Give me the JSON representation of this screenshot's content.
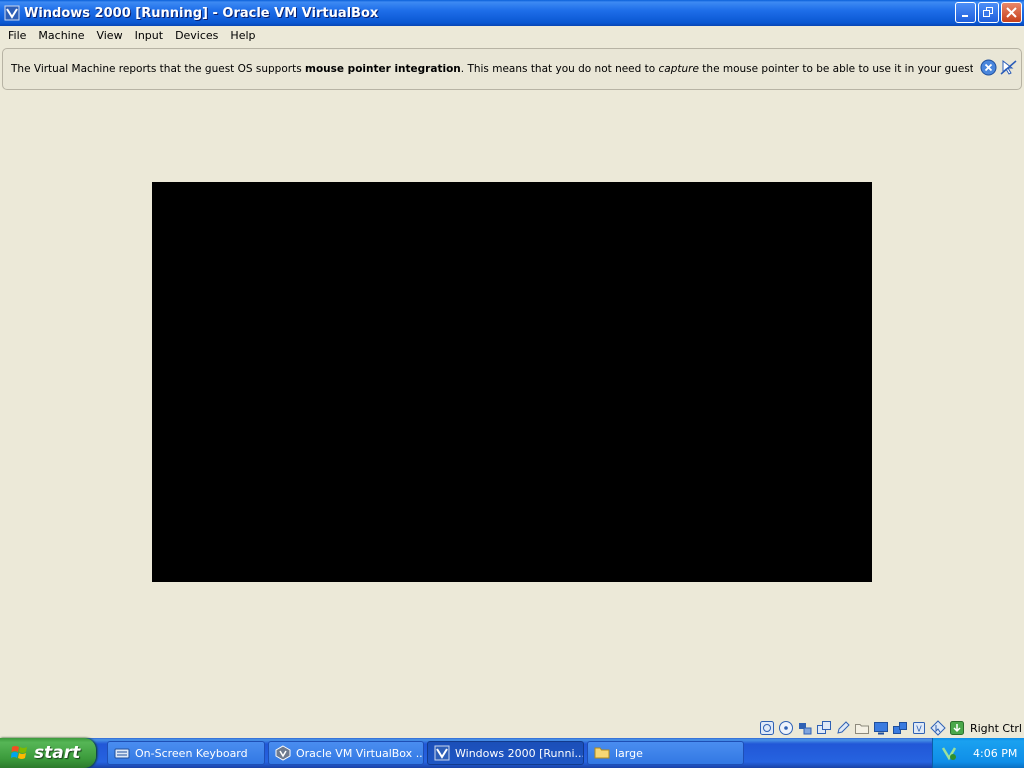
{
  "window": {
    "title": "Windows 2000 [Running] - Oracle VM VirtualBox"
  },
  "menubar": {
    "items": [
      "File",
      "Machine",
      "View",
      "Input",
      "Devices",
      "Help"
    ]
  },
  "banner": {
    "text_1": "The Virtual Machine reports that the guest OS supports ",
    "bold": "mouse pointer integration",
    "text_2": ". This means that you do not need to ",
    "italic": "capture",
    "text_3": " the mouse pointer to be able to use it in your guest OS -- all mouse"
  },
  "statusbar": {
    "host_key": "Right Ctrl",
    "icons": [
      "hard-disk-icon",
      "optical-drive-icon",
      "usb-icon",
      "shared-folders-icon",
      "pencil-icon",
      "folder-icon",
      "display-icon",
      "network-icon",
      "cpu-icon",
      "mouse-integration-icon",
      "host-key-icon"
    ]
  },
  "taskbar": {
    "start_label": "start",
    "tasks": [
      {
        "label": "On-Screen Keyboard",
        "icon": "keyboard-icon",
        "active": false
      },
      {
        "label": "Oracle VM VirtualBox ...",
        "icon": "virtualbox-icon",
        "active": false
      },
      {
        "label": "Windows 2000 [Runni...",
        "icon": "vm-window-icon",
        "active": true
      },
      {
        "label": "large",
        "icon": "folder-icon",
        "active": false
      }
    ],
    "clock": "4:06 PM"
  },
  "colors": {
    "titlebar": "#0a57d2",
    "background": "#ece9d8",
    "vm_screen": "#000000",
    "start_green": "#3b9a3b",
    "taskbar_blue": "#2663e0"
  }
}
